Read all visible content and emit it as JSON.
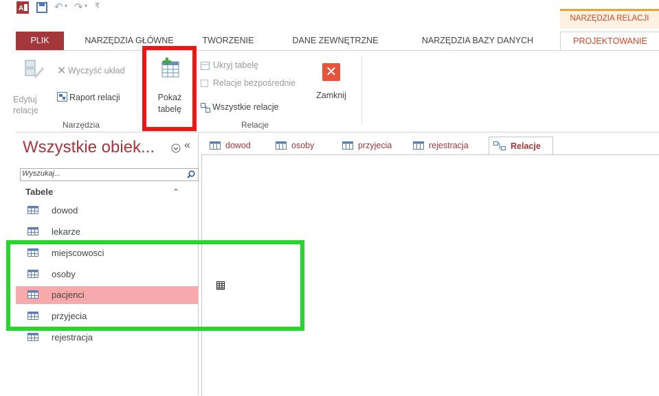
{
  "context_tab": "NARZĘDZIA RELACJI",
  "tabs": [
    "PLIK",
    "NARZĘDZIA GŁÓWNE",
    "TWORZENIE",
    "DANE ZEWNĘTRZNE",
    "NARZĘDZIA BAZY DANYCH",
    "PROJEKTOWANIE"
  ],
  "ribbon": {
    "edit_relations": [
      "Edytuj",
      "relacje"
    ],
    "clear_layout": "Wyczyść układ",
    "relationship_report": "Raport relacji",
    "show_table": [
      "Pokaż",
      "tabelę"
    ],
    "hide_table": "Ukryj tabelę",
    "direct_relations": "Relacje bezpośrednie",
    "all_relations": "Wszystkie relacje",
    "close": "Zamknij",
    "group_tools": "Narzędzia",
    "group_relations": "Relacje"
  },
  "nav": {
    "title": "Wszystkie obiek...",
    "search_placeholder": "Wyszukaj...",
    "section": "Tabele",
    "items": [
      "dowod",
      "lekarze",
      "miejscowosci",
      "osoby",
      "pacjenci",
      "przyjecia",
      "rejestracja"
    ],
    "selected": "pacjenci"
  },
  "doc_tabs": [
    "dowod",
    "osoby",
    "przyjecia",
    "rejestracja",
    "Relacje"
  ],
  "colors": {
    "accent": "#a4373a",
    "highlight_red": "#f01414",
    "highlight_green": "#27d62a",
    "selected_row": "#f8a9ac"
  }
}
